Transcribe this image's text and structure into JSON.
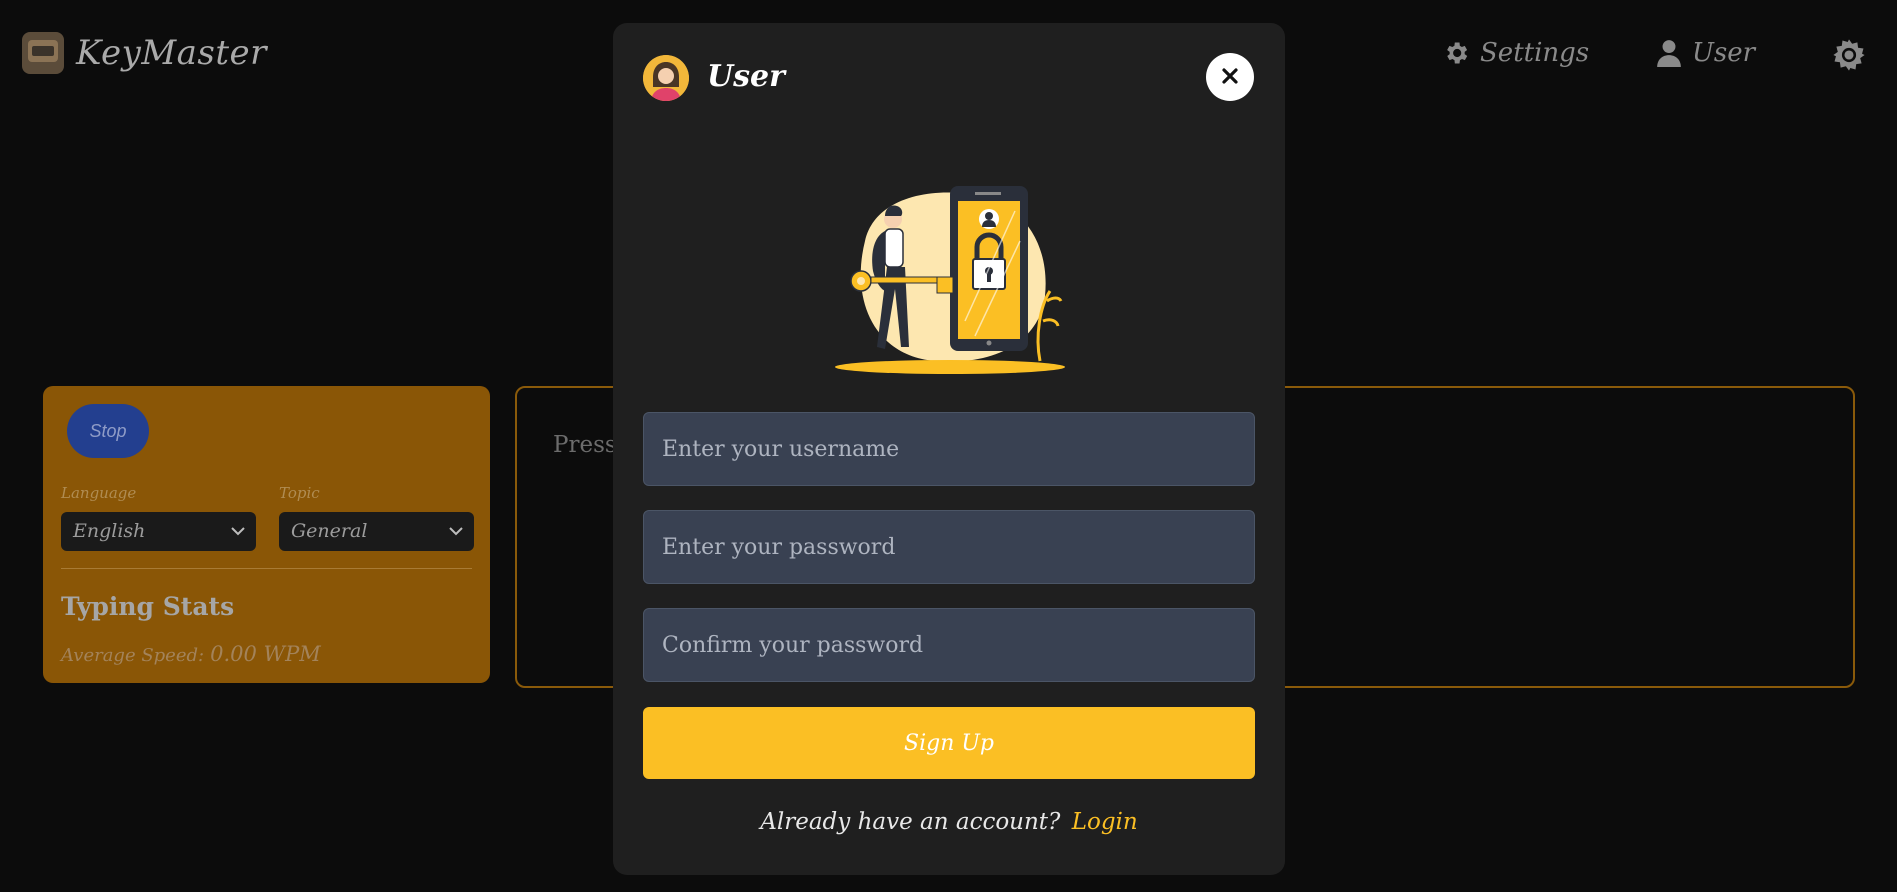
{
  "header": {
    "brand": "KeyMaster",
    "nav": {
      "settings_label": "Settings",
      "user_label": "User"
    },
    "icons": [
      "keyboard-logo-icon",
      "gear-icon",
      "user-icon",
      "theme-toggle-icon"
    ]
  },
  "panel": {
    "stop_label": "Stop",
    "language": {
      "label": "Language",
      "value": "English"
    },
    "topic": {
      "label": "Topic",
      "value": "General"
    },
    "stats_title": "Typing Stats",
    "average_speed_label": "Average Speed:",
    "average_speed_value": "0.00 WPM"
  },
  "textbox": {
    "hint": "Press"
  },
  "modal": {
    "title": "User",
    "username_placeholder": "Enter your username",
    "password_placeholder": "Enter your password",
    "confirm_placeholder": "Confirm your password",
    "signup_label": "Sign Up",
    "login_prompt": "Already have an account?",
    "login_link": "Login"
  },
  "colors": {
    "background": "#0c0c0c",
    "panel": "#8a5606",
    "modal": "#1f1f1f",
    "accent": "#fbbf24",
    "input_bg": "#394152",
    "stop_button": "#233f8f"
  }
}
